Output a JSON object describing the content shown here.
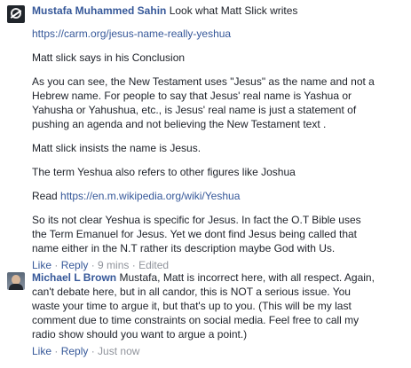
{
  "comments": [
    {
      "author": "Mustafa Muhammed Sahin",
      "avatar_icon": "blocked-symbol-avatar",
      "first_line": "Look what Matt Slick writes",
      "paragraphs": [
        {
          "kind": "link",
          "lines": [
            "https://carm.org/jesus-name-really-yeshua"
          ]
        },
        {
          "kind": "text",
          "lines": [
            "Matt slick says in his Conclusion"
          ]
        },
        {
          "kind": "text",
          "lines": [
            "As you can see, the New Testament uses \"Jesus\" as the name and not a",
            "Hebrew name. For people to say that Jesus' real name is Yashua or",
            "Yahusha or Yahushua, etc., is Jesus' real name is just a statement of",
            "pushing an agenda and not believing the New Testament text ."
          ]
        },
        {
          "kind": "text",
          "lines": [
            "Matt slick insists the name is Jesus."
          ]
        },
        {
          "kind": "text",
          "lines": [
            "The term Yeshua also refers to other figures like Joshua"
          ]
        },
        {
          "kind": "read",
          "prefix": "Read ",
          "link": "https://en.m.wikipedia.org/wiki/Yeshua"
        },
        {
          "kind": "text",
          "lines": [
            "So its not clear Yeshua is specific for Jesus. In fact the O.T Bible uses",
            "the Term Emanuel for Jesus. Yet we dont find Jesus being called that",
            "name either in the N.T rather its description maybe God with Us."
          ]
        }
      ],
      "actions": {
        "like": "Like",
        "reply": "Reply",
        "time": "9 mins",
        "edited": "Edited",
        "sep": " · "
      }
    },
    {
      "author": "Michael L Brown",
      "avatar_icon": "profile-photo-avatar",
      "lines": [
        "Mustafa, Matt is incorrect here, with all respect. Again,",
        "can't debate here, but in all candor, this is NOT a serious issue. You",
        "waste your time to argue it, but that's up to you. (This will be my last",
        "comment due to time constraints on social media. Feel free to call my",
        "radio show should you want to argue a point.)"
      ],
      "actions": {
        "like": "Like",
        "reply": "Reply",
        "time": "Just now",
        "sep": " · "
      }
    }
  ],
  "colors": {
    "link": "#365899",
    "text": "#1d2129",
    "meta": "#90949c"
  }
}
